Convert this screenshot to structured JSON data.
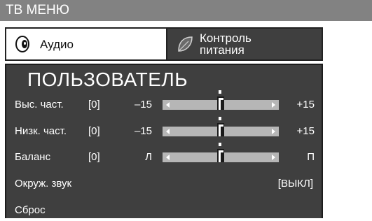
{
  "menu": {
    "title": "ТВ МЕНЮ"
  },
  "tabs": [
    {
      "label": "Аудио",
      "icon": "speaker-icon",
      "active": true
    },
    {
      "label": "Контроль питания",
      "label_line1": "Контроль",
      "label_line2": "питания",
      "icon": "leaf-icon",
      "active": false
    }
  ],
  "panel": {
    "title": "ПОЛЬЗОВАТЕЛЬ",
    "rows": [
      {
        "label": "Выс. част.",
        "value": "[0]",
        "min_label": "–15",
        "max_label": "+15",
        "level": 0.5
      },
      {
        "label": "Низк. част.",
        "value": "[0]",
        "min_label": "–15",
        "max_label": "+15",
        "level": 0.5
      },
      {
        "label": "Баланс",
        "value": "[0]",
        "min_label": "Л",
        "max_label": "П",
        "level": 0.5
      }
    ],
    "surround": {
      "label": "Окруж. звук",
      "value": "[ВЫКЛ]"
    },
    "reset": {
      "label": "Сброс"
    }
  },
  "colors": {
    "title_bar": "#828282",
    "panel_bg": "#3f3f3f",
    "slider_track": "#b6b6b6",
    "text": "#ffffff"
  }
}
